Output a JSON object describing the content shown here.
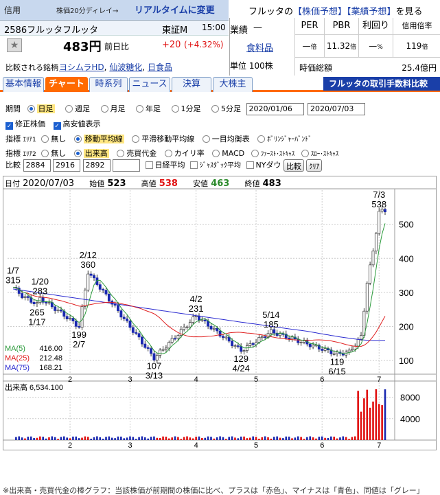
{
  "header": {
    "tag": "信用",
    "delay_note": "株価20分ディレイ→",
    "realtime_link": "リアルタイムに変更",
    "company_prefix": "フルッタの",
    "forecast_link": "【株価予想】",
    "earnings_link": "【業績予想】",
    "suffix": "を見る"
  },
  "stock": {
    "code_name": "2586フルッタフルッタ",
    "market": "東証M",
    "time": "15:00",
    "price": "483円",
    "change_label": "前日比",
    "change": "+20",
    "change_pct": "(+4.32%)",
    "compare_label": "比較される銘柄",
    "compare_links": [
      "ヨシムラHD",
      "仙波糖化",
      "日食品"
    ],
    "compare_sep": ","
  },
  "fin": {
    "perf_label": "業績",
    "perf_value": "—",
    "sector": "食料品",
    "unit_label": "単位",
    "unit_value": "100株",
    "per_h": "PER",
    "pbr_h": "PBR",
    "yield_h": "利回り",
    "margin_h": "信用倍率",
    "per_v": "—",
    "per_u": "倍",
    "pbr_v": "11.32",
    "pbr_u": "倍",
    "yield_v": "—",
    "yield_u": "%",
    "margin_v": "119",
    "margin_u": "倍",
    "cap_label": "時価総額",
    "cap_value": "25.4億円"
  },
  "tabs": [
    "基本情報",
    "チャート",
    "時系列",
    "ニュース",
    "決算",
    "大株主"
  ],
  "promo": "フルッタの取引手数料比較",
  "controls": {
    "period_label": "期間",
    "periods": [
      "日足",
      "週足",
      "月足",
      "年足",
      "1分足",
      "5分足"
    ],
    "date_from": "2020/01/06",
    "date_to": "2020/07/03",
    "adjusted": "修正株価",
    "hilo": "高安値表示",
    "ind1_label": "指標",
    "area1": "ｴﾘｱ1",
    "ind1": [
      "無し",
      "移動平均線",
      "平滑移動平均線",
      "一目均衡表",
      "ﾎﾞﾘﾝｼﾞｬｰﾊﾞﾝﾄﾞ"
    ],
    "ind2_label": "指標",
    "area2": "ｴﾘｱ2",
    "ind2": [
      "無し",
      "出来高",
      "売買代金",
      "カイリ率",
      "MACD",
      "ﾌｧｰｽﾄ･ｽﾄｷｬｽ",
      "ｽﾛｰ･ｽﾄｷｬｽ"
    ],
    "cmp_label": "比較",
    "cmp_codes": [
      "2884",
      "2916",
      "2892",
      ""
    ],
    "cmp_checks": [
      "日経平均",
      "ｼﾞｬｽﾀﾞｯｸ平均",
      "NYダウ"
    ],
    "cmp_btn": "比較",
    "clear_btn": "ｸﾘｱ"
  },
  "ohlc": {
    "date_label": "日付",
    "date": "2020/07/03",
    "open_label": "始値",
    "open": "523",
    "high_label": "高値",
    "high": "538",
    "low_label": "安値",
    "low": "463",
    "close_label": "終値",
    "close": "483"
  },
  "colors": {
    "up": "#e01010",
    "down": "#1a28b0",
    "ma5": "#2a9a3a",
    "ma25": "#e02020",
    "ma75": "#2a2ad0",
    "accent": "#ff6a00",
    "link": "#1a3fa8"
  },
  "chart_data": {
    "type": "candlestick",
    "ylim": [
      60,
      600
    ],
    "y_ticks": [
      100,
      200,
      300,
      400,
      500
    ],
    "x_ticks": [
      "2",
      "3",
      "4",
      "5",
      "6",
      "7"
    ],
    "ma": [
      {
        "name": "MA(5)",
        "value": "416.00"
      },
      {
        "name": "MA(25)",
        "value": "212.48"
      },
      {
        "name": "MA(75)",
        "value": "168.21"
      }
    ],
    "annotations": [
      {
        "d": "1/7",
        "v": "315",
        "day": 0,
        "price": 315,
        "pos": "above"
      },
      {
        "d": "1/17",
        "v": "265",
        "day": 8,
        "price": 265,
        "pos": "below"
      },
      {
        "d": "1/20",
        "v": "283",
        "day": 9,
        "price": 283,
        "pos": "above"
      },
      {
        "d": "2/7",
        "v": "199",
        "day": 22,
        "price": 199,
        "pos": "below"
      },
      {
        "d": "2/12",
        "v": "360",
        "day": 25,
        "price": 360,
        "pos": "above"
      },
      {
        "d": "3/13",
        "v": "107",
        "day": 47,
        "price": 107,
        "pos": "below"
      },
      {
        "d": "4/2",
        "v": "231",
        "day": 61,
        "price": 231,
        "pos": "above"
      },
      {
        "d": "4/24",
        "v": "129",
        "day": 76,
        "price": 129,
        "pos": "below"
      },
      {
        "d": "5/14",
        "v": "185",
        "day": 86,
        "price": 185,
        "pos": "above"
      },
      {
        "d": "6/15",
        "v": "119",
        "day": 108,
        "price": 119,
        "pos": "below"
      },
      {
        "d": "7/3",
        "v": "538",
        "day": 122,
        "price": 538,
        "pos": "above"
      }
    ],
    "volume": {
      "label": "出来高",
      "value": "6,534.100",
      "ylim": [
        0,
        10000
      ],
      "y_ticks": [
        4000,
        8000
      ]
    },
    "navigator": {
      "ticks": [
        "5",
        "7",
        "9",
        "11",
        "0/1",
        "3",
        "5"
      ]
    }
  },
  "footer": "※出来高・売買代金の棒グラフ：当該株価が前期間の株価に比べ、プラスは「赤色」、マイナスは「青色」、同値は「グレー」"
}
